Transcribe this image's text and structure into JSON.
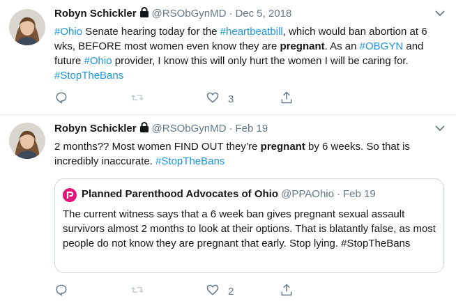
{
  "tweets": [
    {
      "author_name": "Robyn Schickler",
      "handle": "@RSObGynMD",
      "separator": "·",
      "date": "Dec 5, 2018",
      "body": [
        {
          "t": "#Ohio",
          "k": "hashtag"
        },
        {
          "t": " Senate hearing today for the ",
          "k": "text"
        },
        {
          "t": "#heartbeatbill",
          "k": "hashtag"
        },
        {
          "t": ", which would ban abortion at 6 wks, BEFORE most women even know they are ",
          "k": "text"
        },
        {
          "t": "pregnant",
          "k": "bold"
        },
        {
          "t": ". As an ",
          "k": "text"
        },
        {
          "t": "#OBGYN",
          "k": "hashtag"
        },
        {
          "t": " and future ",
          "k": "text"
        },
        {
          "t": "#Ohio",
          "k": "hashtag"
        },
        {
          "t": " provider, I know this will only hurt the women I will be caring for. ",
          "k": "text"
        },
        {
          "t": "#StopTheBans",
          "k": "hashtag"
        }
      ],
      "actions": {
        "reply_count": "",
        "retweet_count": "",
        "like_count": "3"
      }
    },
    {
      "author_name": "Robyn Schickler",
      "handle": "@RSObGynMD",
      "separator": "·",
      "date": "Feb 19",
      "body": [
        {
          "t": "2 months?? Most women FIND OUT they’re ",
          "k": "text"
        },
        {
          "t": "pregnant",
          "k": "bold"
        },
        {
          "t": " by 6 weeks. So that is incredibly inaccurate. ",
          "k": "text"
        },
        {
          "t": "#StopTheBans",
          "k": "hashtag"
        }
      ],
      "quote": {
        "author_name": "Planned Parenthood Advocates of Ohio",
        "handle": "@PPAOhio",
        "separator": "·",
        "date": "Feb 19",
        "text": "The current witness says that a 6 week ban gives pregnant sexual assault survivors almost 2 months to look at their options. That is blatantly false, as most people do not know they are pregnant that early. Stop lying. #StopTheBans"
      },
      "actions": {
        "reply_count": "",
        "retweet_count": "",
        "like_count": "2"
      }
    }
  ],
  "colors": {
    "hashtag": "#1b95e0",
    "muted": "#657786",
    "quote_logo": "#e6127c"
  },
  "icons": [
    "avatar",
    "lock-icon",
    "chevron-down-icon",
    "reply-icon",
    "retweet-icon",
    "like-icon",
    "share-icon",
    "ppa-logo-icon"
  ]
}
